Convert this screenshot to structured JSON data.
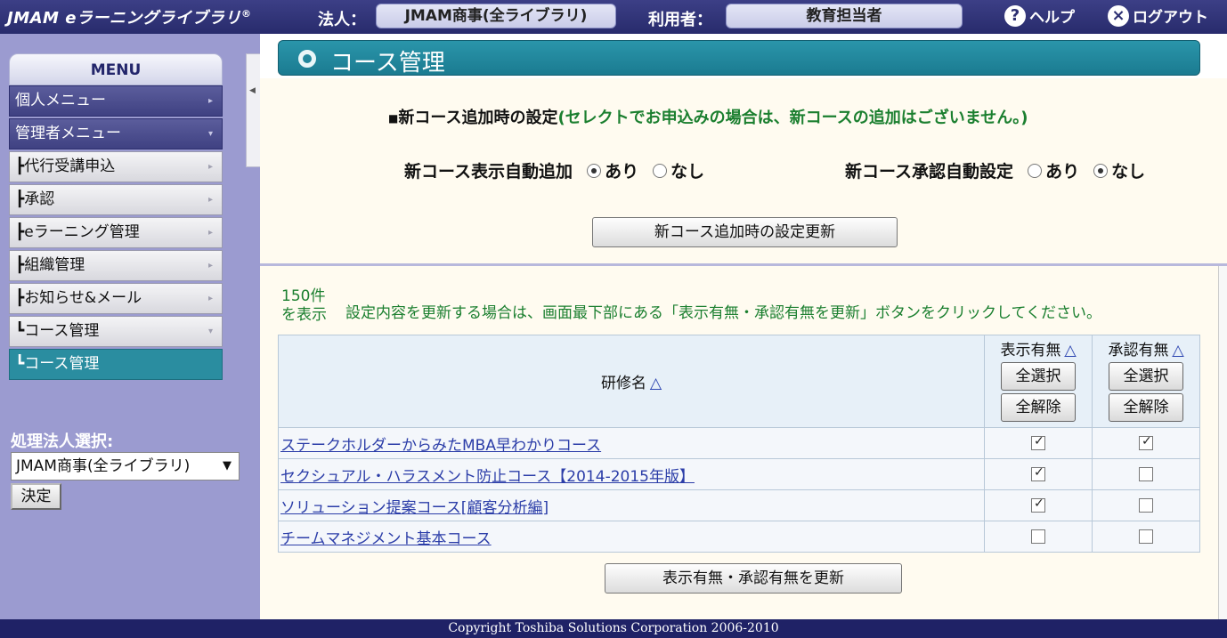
{
  "header": {
    "logo": "JMAM eラーニングライブラリ",
    "logo_mark": "®",
    "corp_label": "法人：",
    "corp_value": "JMAM商事(全ライブラリ)",
    "user_label": "利用者：",
    "user_value": "教育担当者",
    "help_label": "ヘルプ",
    "logout_label": "ログアウト"
  },
  "sidebar": {
    "menu_title": "MENU",
    "items": [
      {
        "label": "個人メニュー",
        "style": "dark"
      },
      {
        "label": "管理者メニュー",
        "style": "dark"
      },
      {
        "label": "┣代行受講申込",
        "style": "light"
      },
      {
        "label": "┣承認",
        "style": "light"
      },
      {
        "label": "┣eラーニング管理",
        "style": "light"
      },
      {
        "label": "┣組織管理",
        "style": "light"
      },
      {
        "label": "┣お知らせ&メール",
        "style": "light"
      },
      {
        "label": "┗コース管理",
        "style": "light"
      },
      {
        "label": "┗コース管理",
        "style": "active"
      }
    ],
    "corp_select_label": "処理法人選択:",
    "corp_select_value": "JMAM商事(全ライブラリ)",
    "decide_label": "決定"
  },
  "main": {
    "title": "コース管理",
    "settings_heading": "新コース追加時の設定",
    "settings_note": "(セレクトでお申込みの場合は、新コースの追加はございません。)",
    "display_auto_label": "新コース表示自動追加",
    "approval_auto_label": "新コース承認自動設定",
    "opt_yes": "あり",
    "opt_no": "なし",
    "display_auto_value": "あり",
    "approval_auto_value": "なし",
    "update_settings_label": "新コース追加時の設定更新",
    "count_line1": "150件",
    "count_line2": "を表示",
    "instruction": "設定内容を更新する場合は、画面最下部にある「表示有無・承認有無を更新」ボタンをクリックしてください。",
    "table": {
      "col_name": "研修名",
      "col_display": "表示有無",
      "col_approval": "承認有無",
      "sort_mark": "△",
      "select_all": "全選択",
      "deselect_all": "全解除",
      "rows": [
        {
          "name": "ステークホルダーからみたMBA早わかりコース",
          "display": true,
          "approval": true
        },
        {
          "name": "セクシュアル・ハラスメント防止コース【2014-2015年版】",
          "display": true,
          "approval": false
        },
        {
          "name": "ソリューション提案コース[顧客分析編]",
          "display": true,
          "approval": false
        },
        {
          "name": "チームマネジメント基本コース",
          "display": false,
          "approval": false
        }
      ]
    },
    "update_flags_label": "表示有無・承認有無を更新"
  },
  "footer": {
    "copyright": "Copyright Toshiba Solutions Corporation 2006-2010"
  }
}
